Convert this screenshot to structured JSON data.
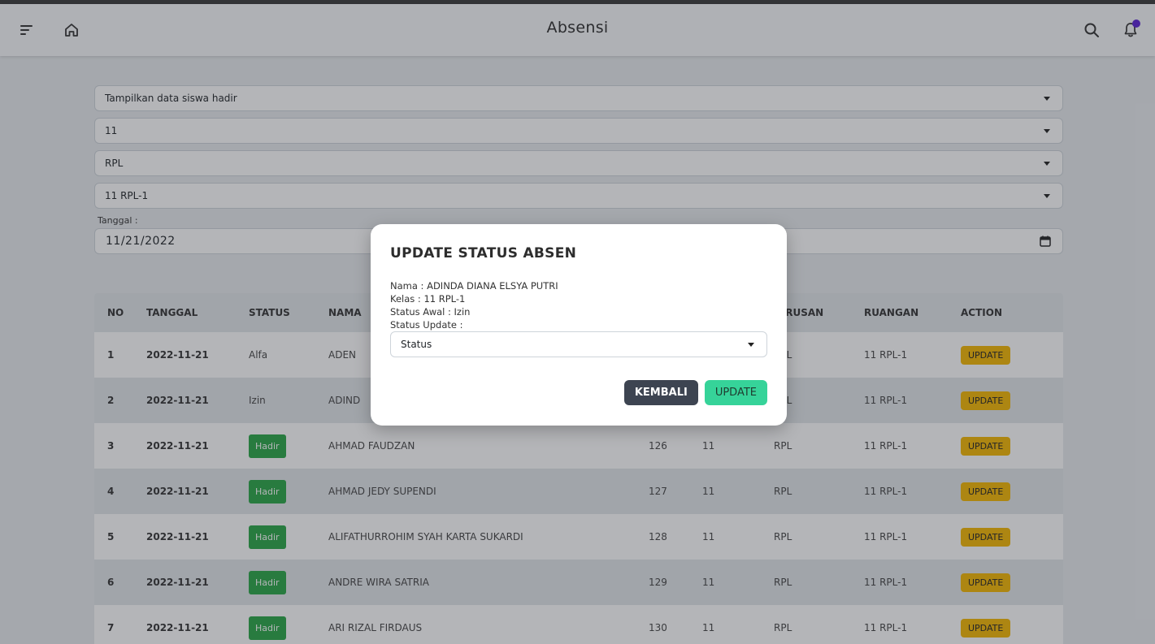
{
  "header": {
    "title": "Absensi"
  },
  "filters": {
    "data_filter": "Tampilkan data siswa hadir",
    "tingkat": "11",
    "jurusan": "RPL",
    "kelas": "11 RPL-1",
    "date_label": "Tanggal :",
    "date_value": "11/21/2022"
  },
  "table": {
    "headers": [
      "NO",
      "TANGGAL",
      "STATUS",
      "NAMA",
      "",
      "",
      "JURUSAN",
      "RUANGAN",
      "ACTION"
    ],
    "action_label": "UPDATE",
    "rows": [
      {
        "no": "1",
        "tanggal": "2022-11-21",
        "status": "Alfa",
        "nama": "ADEN",
        "nis": "",
        "kelas": "",
        "jurusan": "RPL",
        "ruangan": "11 RPL-1"
      },
      {
        "no": "2",
        "tanggal": "2022-11-21",
        "status": "Izin",
        "nama": "ADIND",
        "nis": "",
        "kelas": "",
        "jurusan": "RPL",
        "ruangan": "11 RPL-1"
      },
      {
        "no": "3",
        "tanggal": "2022-11-21",
        "status": "Hadir",
        "nama": "AHMAD FAUDZAN",
        "nis": "126",
        "kelas": "11",
        "jurusan": "RPL",
        "ruangan": "11 RPL-1"
      },
      {
        "no": "4",
        "tanggal": "2022-11-21",
        "status": "Hadir",
        "nama": "AHMAD JEDY SUPENDI",
        "nis": "127",
        "kelas": "11",
        "jurusan": "RPL",
        "ruangan": "11 RPL-1"
      },
      {
        "no": "5",
        "tanggal": "2022-11-21",
        "status": "Hadir",
        "nama": "ALIFATHURROHIM SYAH KARTA SUKARDI",
        "nis": "128",
        "kelas": "11",
        "jurusan": "RPL",
        "ruangan": "11 RPL-1"
      },
      {
        "no": "6",
        "tanggal": "2022-11-21",
        "status": "Hadir",
        "nama": "ANDRE WIRA SATRIA",
        "nis": "129",
        "kelas": "11",
        "jurusan": "RPL",
        "ruangan": "11 RPL-1"
      },
      {
        "no": "7",
        "tanggal": "2022-11-21",
        "status": "Hadir",
        "nama": "ARI RIZAL FIRDAUS",
        "nis": "130",
        "kelas": "11",
        "jurusan": "RPL",
        "ruangan": "11 RPL-1"
      }
    ]
  },
  "modal": {
    "title": "UPDATE STATUS ABSEN",
    "nama": "Nama : ADINDA DIANA ELSYA PUTRI",
    "kelas": "Kelas : 11 RPL-1",
    "status_awal": "Status Awal : Izin",
    "status_update_label": "Status Update :",
    "status_select": "Status",
    "back_label": "KEMBALI",
    "update_label": "UPDATE"
  },
  "colors": {
    "hadir": "#28a745",
    "update_row": "#f5b700",
    "modal_update": "#36d399",
    "modal_back": "#3d4451",
    "notif_dot": "#5b21d6"
  }
}
